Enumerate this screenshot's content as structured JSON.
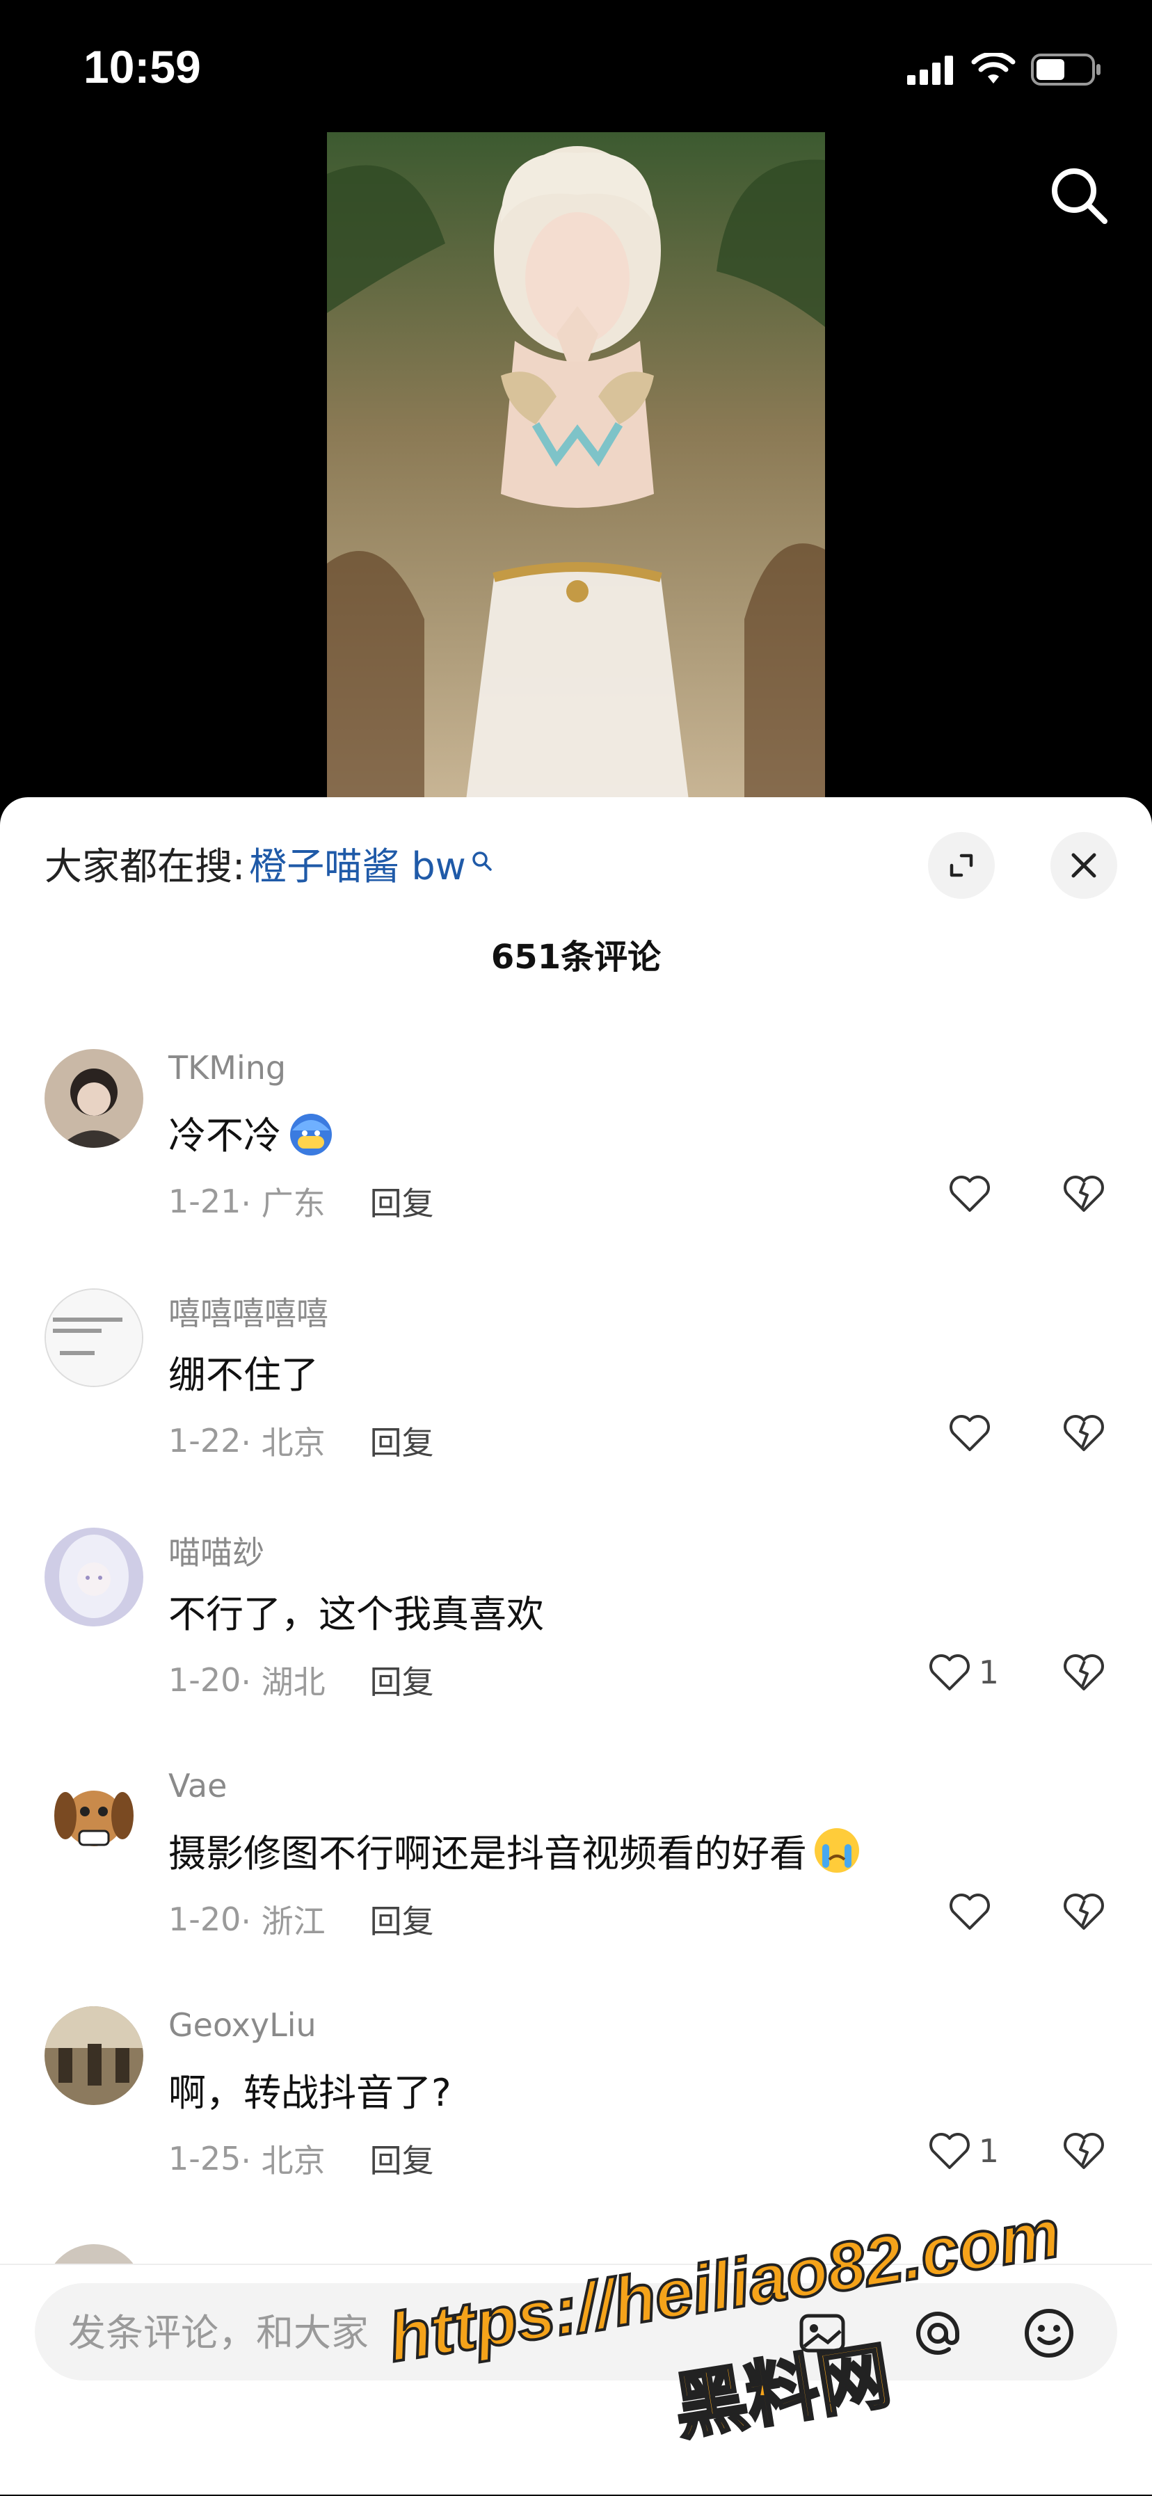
{
  "status_bar": {
    "time": "10:59",
    "icons": [
      "signal-icon",
      "wifi-icon",
      "battery-icon"
    ]
  },
  "video": {
    "icons": [
      "search-icon"
    ]
  },
  "sheet": {
    "hot_search_label": "大家都在搜:",
    "hot_search_term": "橙子喵酱 bw",
    "comment_count": "651条评论",
    "icons": [
      "search-small-icon",
      "expand-icon",
      "close-icon"
    ]
  },
  "comments": [
    {
      "user": "TKMing",
      "text": "冷不冷",
      "emoji": "cold-face-emoji",
      "date": "1-21",
      "location": "· 广东",
      "reply": "回复",
      "likes": ""
    },
    {
      "user": "嘻嘻嘻嘻嘻",
      "text": "绷不住了",
      "emoji": "",
      "date": "1-22",
      "location": "· 北京",
      "reply": "回复",
      "likes": ""
    },
    {
      "user": "喵喵玅",
      "text": "不行了，这个我真喜欢",
      "emoji": "",
      "date": "1-20",
      "location": "· 湖北",
      "reply": "回复",
      "likes": "1"
    },
    {
      "user": "Vae",
      "text": "摄影修图不行啊还是抖音视频看的好看",
      "emoji": "crying-face-emoji",
      "date": "1-20",
      "location": "· 浙江",
      "reply": "回复",
      "likes": ""
    },
    {
      "user": "GeoxyLiu",
      "text": "啊，转战抖音了?",
      "emoji": "",
      "date": "1-25",
      "location": "· 北京",
      "reply": "回复",
      "likes": "1"
    }
  ],
  "bottom": {
    "placeholder": "发条评论，和大家",
    "icons": [
      "image-icon",
      "at-icon",
      "emoji-icon"
    ]
  },
  "watermark": {
    "url": "https://heiliao82.com",
    "cn": "黑料网"
  },
  "colors": {
    "link": "#1f5aa8",
    "background": "#000000",
    "sheet": "#ffffff"
  }
}
